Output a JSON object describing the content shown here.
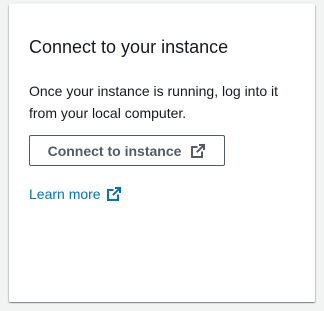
{
  "card": {
    "title": "Connect to your instance",
    "description": "Once your instance is running, log into it from your local computer.",
    "connect_button_label": "Connect to instance",
    "learn_more_label": "Learn more"
  },
  "icons": {
    "connect_button_icon": "external-link-icon",
    "learn_more_icon": "external-link-icon"
  },
  "colors": {
    "text_primary": "#16191f",
    "button_border": "#545b64",
    "link": "#0073bb",
    "page_background": "#f2f3f3",
    "card_background": "#ffffff"
  }
}
